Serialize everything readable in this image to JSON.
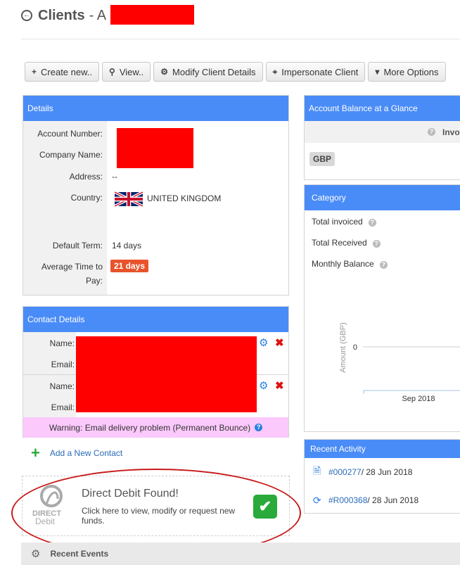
{
  "header": {
    "title": "Clients",
    "title_suffix": "- A"
  },
  "toolbar": [
    {
      "icon": "+",
      "label": "Create new.."
    },
    {
      "icon": "🔍",
      "label": "View.."
    },
    {
      "icon": "⚙",
      "label": "Modify Client Details"
    },
    {
      "icon": "⌖",
      "label": "Impersonate Client"
    },
    {
      "icon": "▾",
      "label": "More Options"
    }
  ],
  "details": {
    "heading": "Details",
    "account_number_label": "Account Number:",
    "company_name_label": "Company Name:",
    "address_label": "Address:",
    "address_value": "--",
    "country_label": "Country:",
    "country_value": "UNITED KINGDOM",
    "default_term_label": "Default Term:",
    "default_term_value": "14 days",
    "avg_time_label_1": "Average Time to",
    "avg_time_label_2": "Pay:",
    "avg_time_value": "21 days"
  },
  "contacts": {
    "heading": "Contact Details",
    "name_label": "Name:",
    "email_label": "Email:",
    "warning": "Warning: Email delivery problem (Permanent Bounce)",
    "add_label": "Add a New Contact"
  },
  "direct_debit": {
    "title": "Direct Debit Found!",
    "description": "Click here to view, modify or request new funds.",
    "logo_top": "DIRECT",
    "logo_bottom": "Debit"
  },
  "recent_events": {
    "label": "Recent Events"
  },
  "account_balance": {
    "heading": "Account Balance at a Glance",
    "column": "Invo",
    "currency": "GBP"
  },
  "category": {
    "heading": "Category",
    "rows": [
      "Total invoiced",
      "Total Received",
      "Monthly Balance"
    ]
  },
  "chart_data": {
    "type": "line",
    "ylabel": "Amount (GBP)",
    "categories": [
      "Sep 2018"
    ],
    "y_ticks": [
      "0"
    ],
    "series": [],
    "grid": false
  },
  "activity": {
    "heading": "Recent Activity",
    "items": [
      {
        "ref": "#000277",
        "date": " / 28 Jun 2018",
        "icon": "document-icon"
      },
      {
        "ref": "#R000368",
        "date": " / 28 Jun 2018",
        "icon": "refresh-icon"
      }
    ]
  },
  "colors": {
    "panel_header": "#4a8cf7",
    "warning_bg": "#fbc9fb",
    "badge": "#e8532b",
    "redaction": "#ff0000"
  }
}
